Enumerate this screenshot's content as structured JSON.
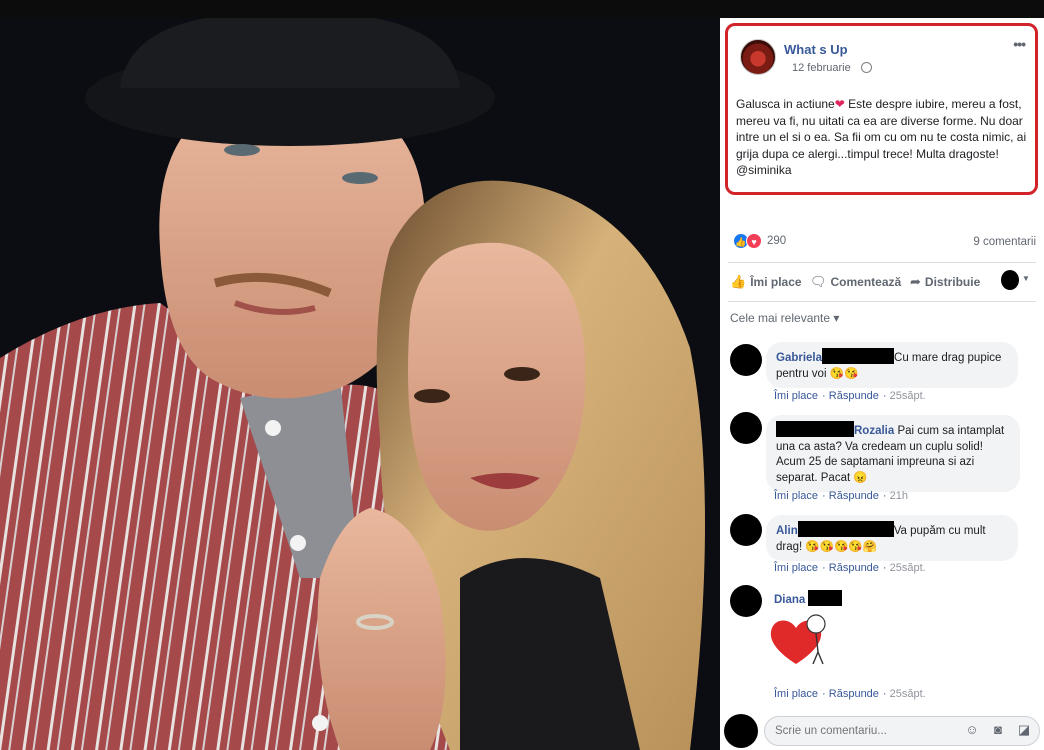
{
  "post": {
    "page_name": "What s Up",
    "date": "12 februarie",
    "text_before_heart": "Galusca in actiune",
    "heart": "❤",
    "text_after_heart": " Este despre iubire, mereu a fost, mereu va fi, nu uitati ca ea are diverse forme. Nu doar intre un el si o ea. Sa fii om cu om nu te costa nimic, ai grija dupa ce alergi...timpul trece! Multa dragoste!",
    "mention": "@siminika",
    "more": "•••"
  },
  "stats": {
    "reactions": "290",
    "comments": "9 comentarii"
  },
  "actions": {
    "like": "Îmi place",
    "comment": "Comentează",
    "share": "Distribuie"
  },
  "sort_label": "Cele mai relevante ▾",
  "comments": [
    {
      "name": "Gabriela",
      "text": "Cu mare drag pupice pentru voi 😘😘",
      "like": "Îmi place",
      "reply": "Răspunde",
      "time": "25săpt."
    },
    {
      "name": "Rozalia",
      "text": " Pai cum sa intamplat una ca asta? Va credeam un cuplu solid! Acum 25 de saptamani impreuna si azi separat. Pacat 😠",
      "like": "Îmi place",
      "reply": "Răspunde",
      "time": "21h"
    },
    {
      "name": "Alin",
      "text": "Va pupăm cu mult drag! 😘😘😘😘🤗",
      "like": "Îmi place",
      "reply": "Răspunde",
      "time": "25săpt."
    },
    {
      "name": "Diana",
      "text": "",
      "like": "Îmi place",
      "reply": "Răspunde",
      "time": "25săpt."
    }
  ],
  "composer": {
    "placeholder": "Scrie un comentariu..."
  },
  "colors": {
    "highlight_border": "#d2232a",
    "link_blue": "#385898",
    "like_blue": "#1877f2",
    "love_red": "#f33e58"
  }
}
